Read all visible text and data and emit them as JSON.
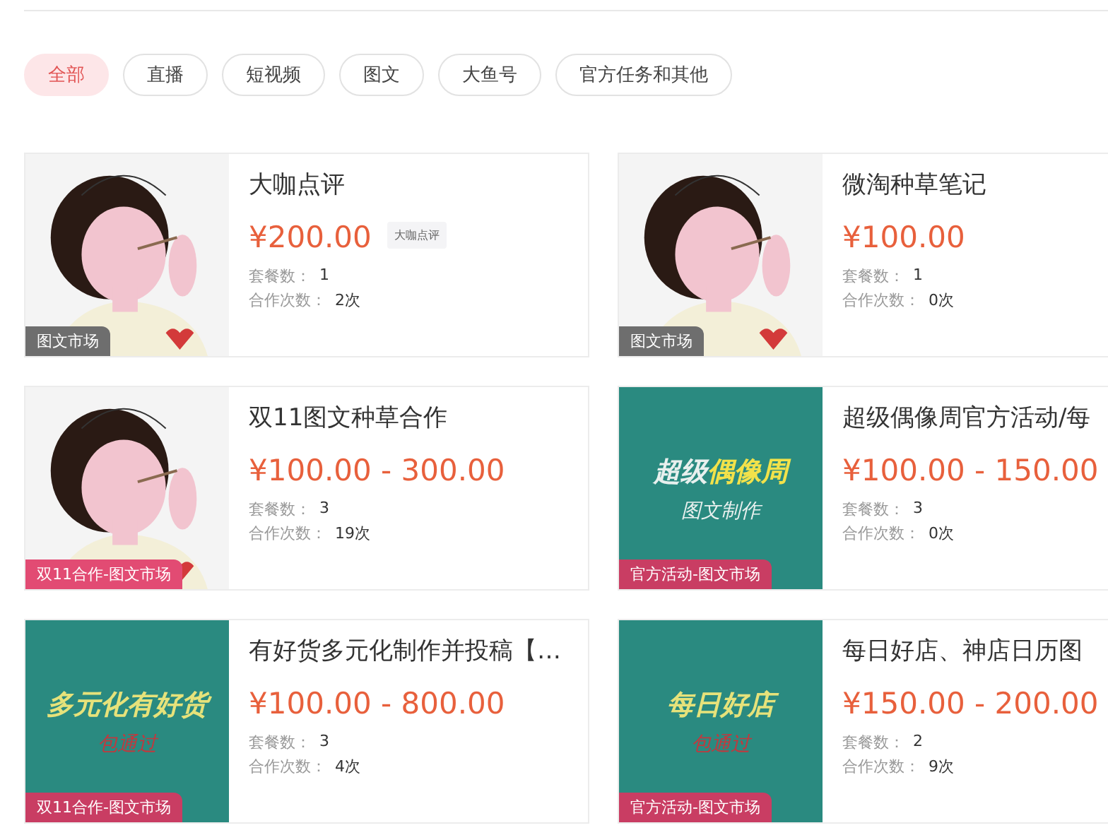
{
  "tabs": [
    {
      "label": "全部",
      "selected": true
    },
    {
      "label": "直播",
      "selected": false
    },
    {
      "label": "短视频",
      "selected": false
    },
    {
      "label": "图文",
      "selected": false
    },
    {
      "label": "大鱼号",
      "selected": false
    },
    {
      "label": "官方任务和其他",
      "selected": false
    }
  ],
  "cards": [
    {
      "badge": {
        "text": "图文市场",
        "color": "#6e6e6e"
      },
      "title": "大咖点评",
      "price": "¥200.00",
      "tooltip": "大咖点评",
      "package_label": "套餐数：",
      "package_count": "1",
      "coop_label": "合作次数：",
      "coop_count": "2次"
    },
    {
      "badge": {
        "text": "图文市场",
        "color": "#6e6e6e"
      },
      "title": "微淘种草笔记",
      "price": "¥100.00",
      "package_label": "套餐数：",
      "package_count": "1",
      "coop_label": "合作次数：",
      "coop_count": "0次"
    },
    {
      "badge": {
        "text": "双11合作-图文市场",
        "color": "#e24b73"
      },
      "title": "双11图文种草合作",
      "price": "¥100.00 - 300.00",
      "package_label": "套餐数：",
      "package_count": "3",
      "coop_label": "合作次数：",
      "coop_count": "19次"
    },
    {
      "image": {
        "kind": "banner",
        "lines": [
          {
            "parts": [
              {
                "text": "超级",
                "color": "#e8f0ee"
              },
              {
                "text": "偶像周",
                "color": "#f2e24a"
              }
            ]
          },
          {
            "parts": [
              {
                "text": "图文制作",
                "color": "#e8f0ee"
              }
            ]
          }
        ]
      },
      "badge": {
        "text": "官方活动-图文市场",
        "color": "#c93d63"
      },
      "title": "超级偶像周官方活动/每",
      "price": "¥100.00 - 150.00",
      "package_label": "套餐数：",
      "package_count": "3",
      "coop_label": "合作次数：",
      "coop_count": "0次"
    },
    {
      "image": {
        "kind": "banner",
        "lines": [
          {
            "parts": [
              {
                "text": "多元化有好货",
                "color": "#e6e27a"
              }
            ]
          },
          {
            "parts": [
              {
                "text": "包通过",
                "color": "#c0393e"
              }
            ]
          }
        ]
      },
      "badge": {
        "text": "双11合作-图文市场",
        "color": "#c93d63"
      },
      "title": "有好货多元化制作并投稿【…",
      "price": "¥100.00 - 800.00",
      "package_label": "套餐数：",
      "package_count": "3",
      "coop_label": "合作次数：",
      "coop_count": "4次"
    },
    {
      "image": {
        "kind": "banner",
        "lines": [
          {
            "parts": [
              {
                "text": "每日好店",
                "color": "#e6e27a"
              }
            ]
          },
          {
            "parts": [
              {
                "text": "包通过",
                "color": "#c0393e"
              }
            ]
          }
        ]
      },
      "badge": {
        "text": "官方活动-图文市场",
        "color": "#c93d63"
      },
      "title": "每日好店、神店日历图",
      "price": "¥150.00 - 200.00",
      "package_label": "套餐数：",
      "package_count": "2",
      "coop_label": "合作次数：",
      "coop_count": "9次"
    }
  ]
}
